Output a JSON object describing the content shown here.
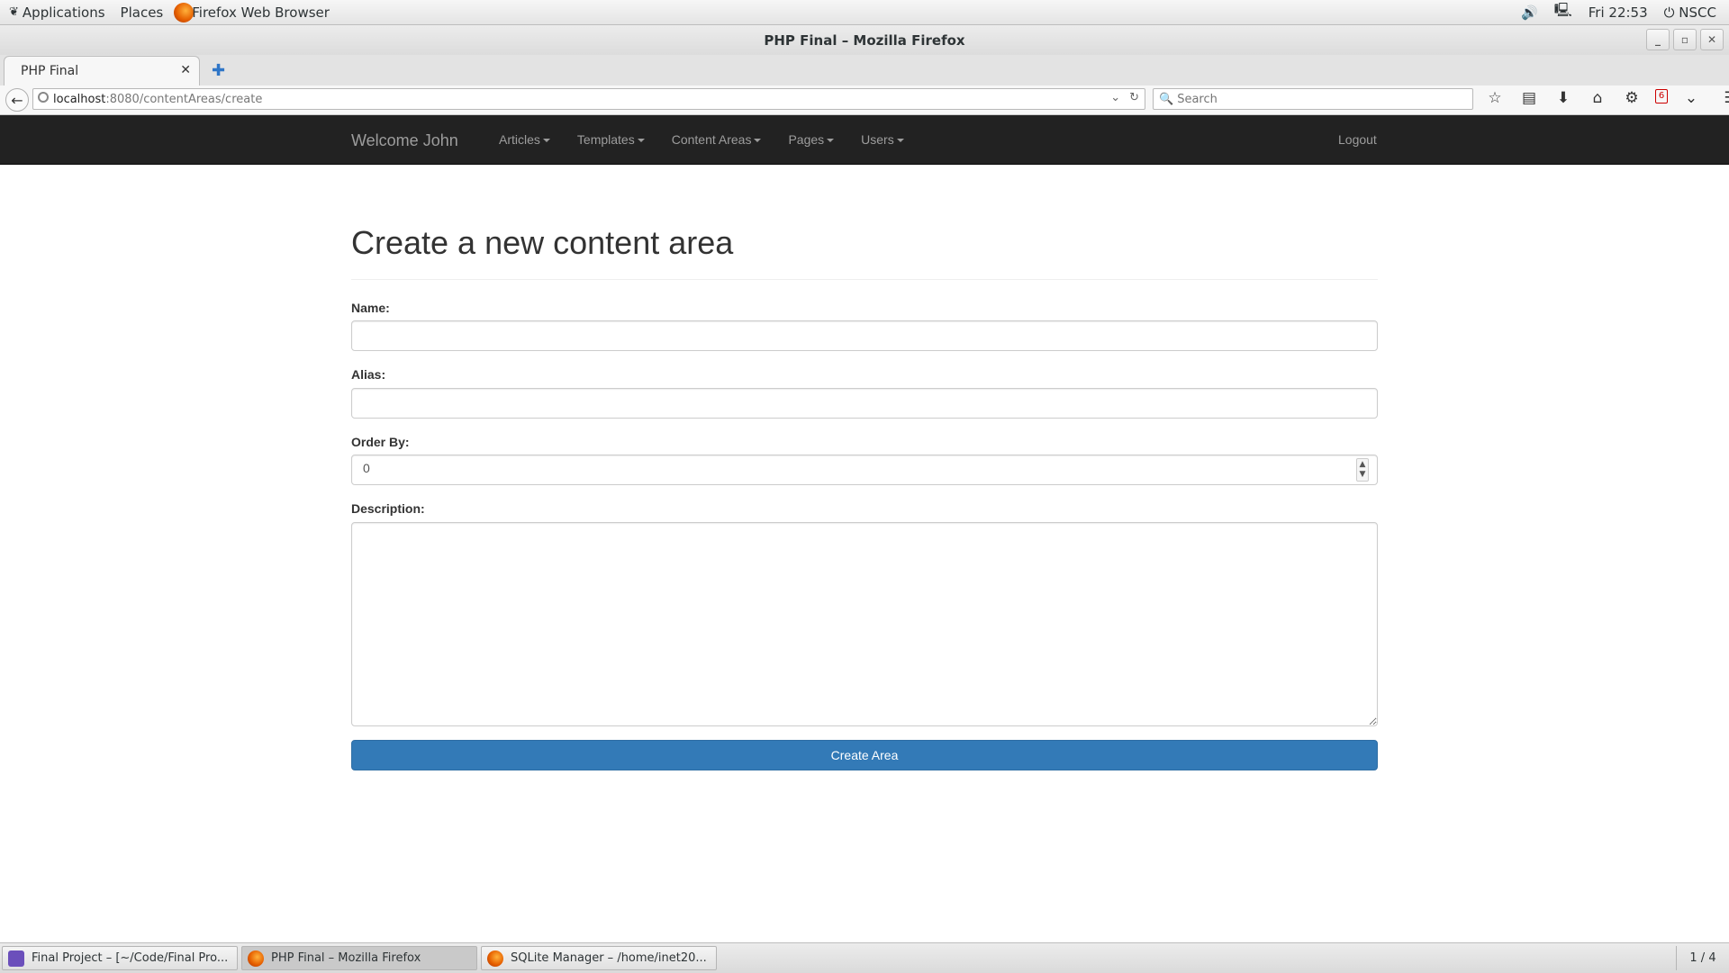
{
  "top_panel": {
    "applications_label": "Applications",
    "places_label": "Places",
    "active_app_label": "Firefox Web Browser",
    "clock": "Fri 22:53",
    "user_label": "NSCC"
  },
  "window": {
    "title": "PHP Final – Mozilla Firefox"
  },
  "browser": {
    "tab_title": "PHP Final",
    "url_host": "localhost",
    "url_rest": ":8080/contentAreas/create",
    "search_placeholder": "Search",
    "notification_count": "6"
  },
  "site_nav": {
    "brand": "Welcome John",
    "menu": [
      {
        "label": "Articles"
      },
      {
        "label": "Templates"
      },
      {
        "label": "Content Areas"
      },
      {
        "label": "Pages"
      },
      {
        "label": "Users"
      }
    ],
    "logout_label": "Logout"
  },
  "form": {
    "heading": "Create a new content area",
    "name_label": "Name:",
    "name_value": "",
    "alias_label": "Alias:",
    "alias_value": "",
    "order_label": "Order By:",
    "order_value": "0",
    "description_label": "Description:",
    "description_value": "",
    "submit_label": "Create Area"
  },
  "taskbar": {
    "tasks": [
      {
        "label": "Final Project – [~/Code/Final Pro..."
      },
      {
        "label": "PHP Final – Mozilla Firefox"
      },
      {
        "label": "SQLite Manager – /home/inet20..."
      }
    ],
    "workspace": "1 / 4"
  },
  "colors": {
    "navbar_bg": "#222222",
    "primary_button": "#337ab7"
  }
}
